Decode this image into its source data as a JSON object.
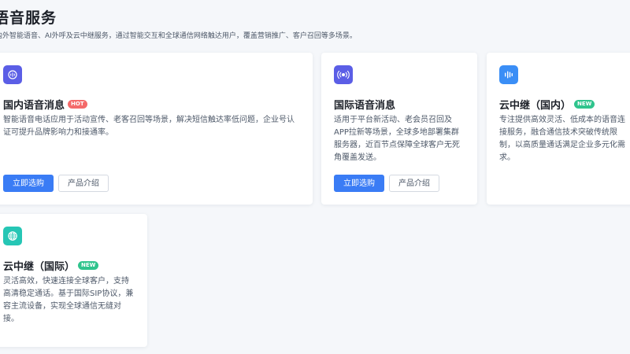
{
  "header": {
    "title": "语音服务",
    "subtitle": "内外智能语音、AI外呼及云中继服务，通过智能交互和全球通信网络触达用户，覆盖营销推广、客户召回等多场景。"
  },
  "colors": {
    "primary": "#3a7cf5",
    "hot_badge": "#f46a6a",
    "new_badge": "#2fc48d",
    "icon_purple": "#5b5ee6",
    "icon_blue": "#3a8ef6",
    "icon_teal": "#26c6b5"
  },
  "cards": [
    {
      "title": "国内语音消息",
      "badge": "HOT",
      "icon": "voice-message-icon",
      "desc_lines": [
        "智能语音电话应用于活动宣传、老客召回等场景，解决短信触达率低问题，企业号认",
        "证可提升品牌影响力和接通率。"
      ],
      "buy_label": "立即选购",
      "intro_label": "产品介绍"
    },
    {
      "title": "国际语音消息",
      "badge": "",
      "icon": "broadcast-icon",
      "desc_lines": [
        "适用于平台新活动、老会员召回及",
        "APP拉新等场景，全球多地部署集群",
        "服务器，近百节点保障全球客户无死",
        "角覆盖发送。"
      ],
      "buy_label": "立即选购",
      "intro_label": "产品介绍"
    },
    {
      "title": "云中继（国内）",
      "badge": "NEW",
      "icon": "sound-wave-icon",
      "desc_lines": [
        "专注提供高效灵活、低成本的语音连",
        "接服务，融合通信技术突破传统限",
        "制，以高质量通话满足企业多元化需",
        "求。"
      ]
    },
    {
      "title": "云中继（国际）",
      "badge": "NEW",
      "icon": "globe-icon",
      "desc_lines": [
        "灵活高效，快速连接全球客户，支持",
        "高清稳定通话。基于国际SIP协议，兼",
        "容主流设备，实现全球通信无缝对",
        "接。"
      ]
    }
  ]
}
